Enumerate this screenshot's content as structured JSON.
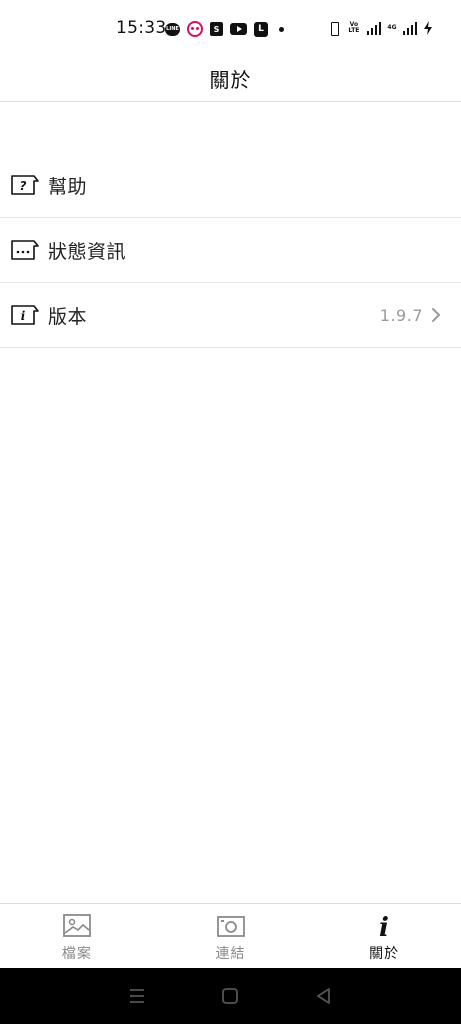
{
  "status_bar": {
    "time": "15:33",
    "notification_icons": [
      "line-icon",
      "foodpanda-icon",
      "shopee-icon",
      "youtube-icon",
      "l-app-icon",
      "more-dot-icon"
    ],
    "line_text": "LINE",
    "shopee_text": "S",
    "l_app_text": "L",
    "volte_text": "Vo LTE",
    "network_text": "4G"
  },
  "header": {
    "title": "關於"
  },
  "menu": {
    "items": [
      {
        "label": "幫助",
        "icon": "help-icon"
      },
      {
        "label": "狀態資訊",
        "icon": "status-info-icon"
      },
      {
        "label": "版本",
        "icon": "info-icon",
        "value": "1.9.7"
      }
    ]
  },
  "tabs": [
    {
      "label": "檔案",
      "icon": "image-file-icon",
      "active": false
    },
    {
      "label": "連結",
      "icon": "camera-icon",
      "active": false
    },
    {
      "label": "關於",
      "icon": "info-i-icon",
      "active": true
    }
  ],
  "nav_bar": {
    "buttons": [
      "menu-icon",
      "home-icon",
      "back-icon"
    ]
  },
  "colors": {
    "background": "#ffffff",
    "text_primary": "#222222",
    "text_secondary": "#9a9a9a",
    "tab_inactive": "#8a8a8a",
    "divider": "#e6e6e6",
    "nav_bar": "#000000"
  }
}
